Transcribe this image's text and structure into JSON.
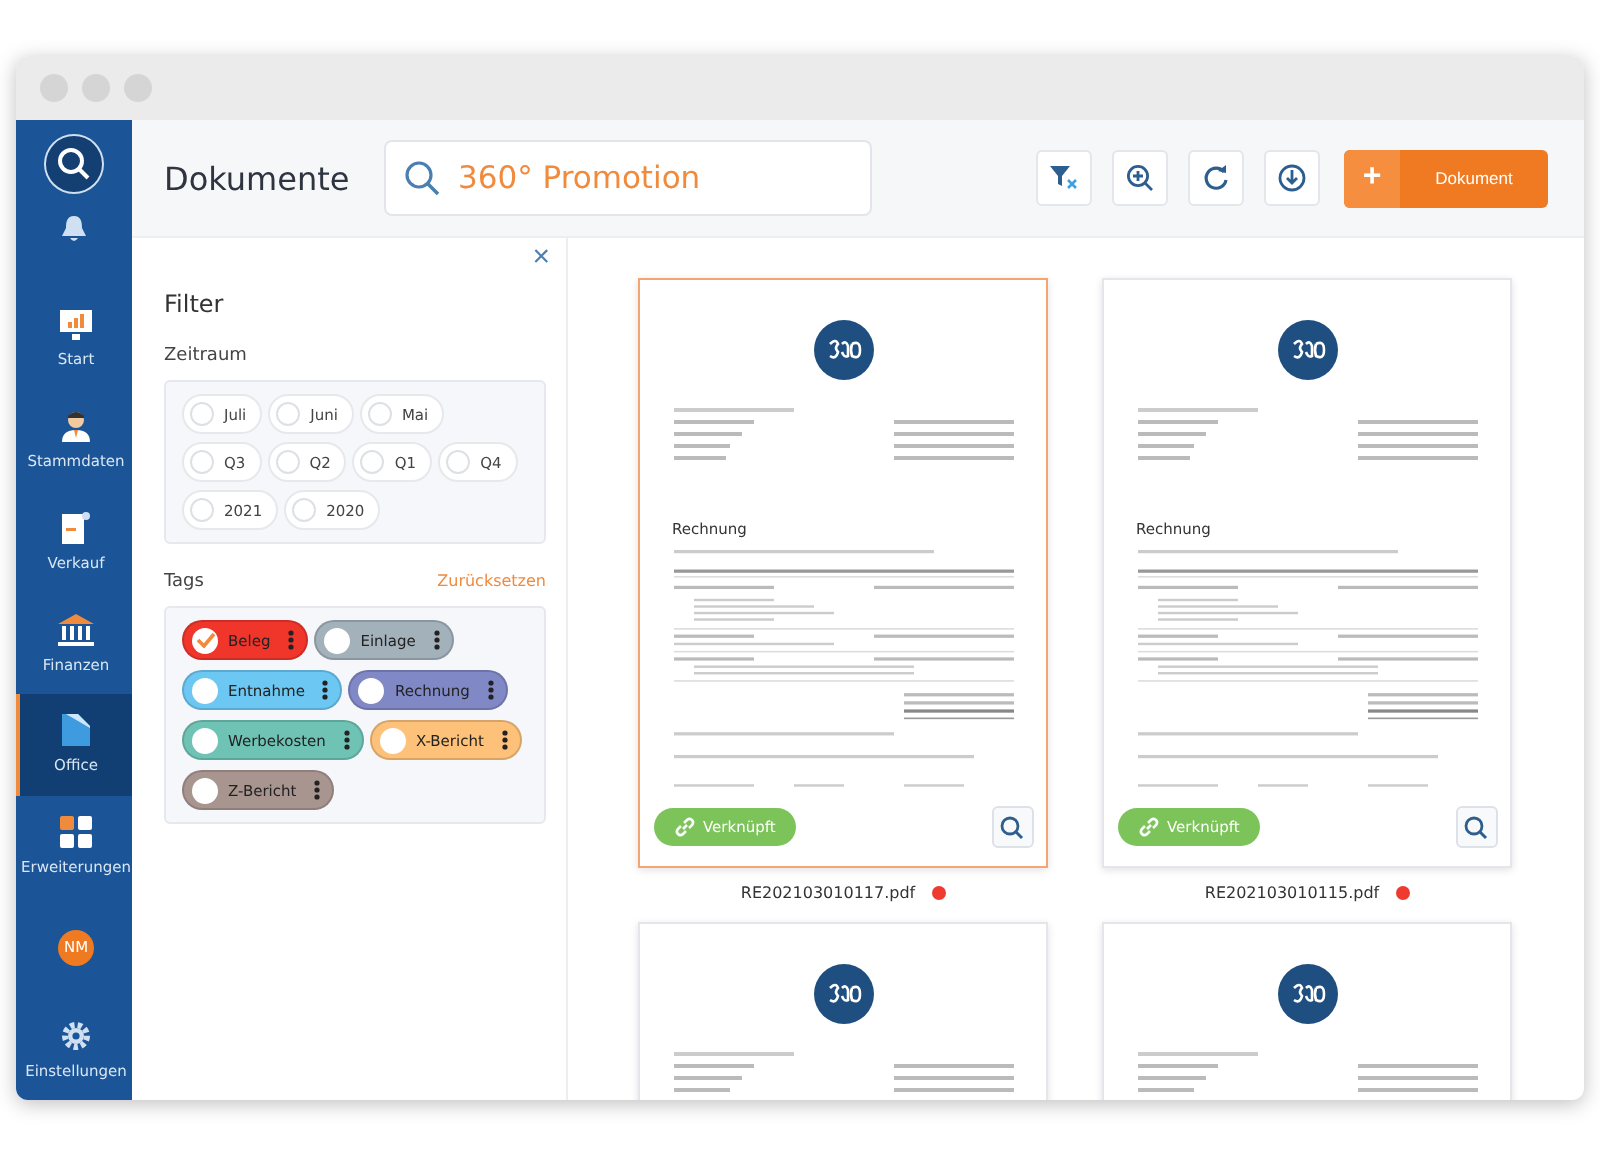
{
  "sidebar": {
    "items": [
      {
        "kind": "search"
      },
      {
        "kind": "bell"
      },
      {
        "kind": "chart",
        "label": "Start",
        "selected": false
      },
      {
        "kind": "person",
        "label": "Stammdaten",
        "selected": false
      },
      {
        "kind": "doc",
        "label": "Verkauf",
        "selected": false
      },
      {
        "kind": "bank",
        "label": "Finanzen",
        "selected": false
      },
      {
        "kind": "office",
        "label": "Office",
        "selected": true
      },
      {
        "kind": "grid",
        "label": "Erweiterungen",
        "selected": false
      },
      {
        "kind": "avatar",
        "label": "NM"
      },
      {
        "kind": "gear",
        "label": "Einstellungen",
        "selected": false
      }
    ]
  },
  "header": {
    "title": "Dokumente",
    "search": {
      "value": "360° Promotion"
    },
    "new_button": {
      "icon": "+",
      "label": "Dokument"
    }
  },
  "filter": {
    "title": "Filter",
    "close": "×",
    "period_label": "Zeitraum",
    "periods": [
      {
        "label": "Juli",
        "selected": false
      },
      {
        "label": "Juni",
        "selected": false
      },
      {
        "label": "Mai",
        "selected": false
      },
      {
        "label": "Q3",
        "selected": false
      },
      {
        "label": "Q2",
        "selected": false
      },
      {
        "label": "Q1",
        "selected": false
      },
      {
        "label": "Q4",
        "selected": false
      },
      {
        "label": "2021",
        "selected": false
      },
      {
        "label": "2020",
        "selected": false
      }
    ],
    "tags_label": "Tags",
    "reset": "Zurücksetzen",
    "tags": [
      {
        "label": "Beleg",
        "checked": true,
        "color": "#f0352b"
      },
      {
        "label": "Einlage",
        "checked": false,
        "color": "#a3b1bb"
      },
      {
        "label": "Entnahme",
        "checked": false,
        "color": "#6cc7f2"
      },
      {
        "label": "Rechnung",
        "checked": false,
        "color": "#8088c6"
      },
      {
        "label": "Werbekosten",
        "checked": false,
        "color": "#6fc3b5"
      },
      {
        "label": "X-Bericht",
        "checked": false,
        "color": "#fdc17a"
      },
      {
        "label": "Z-Bericht",
        "checked": false,
        "color": "#a89590"
      }
    ]
  },
  "documents": [
    {
      "heading": "Rechnung",
      "selected": true,
      "link": "Verknüpft",
      "filename": "RE202103010117.pdf",
      "color": "#ef3a2e"
    },
    {
      "heading": "Rechnung",
      "selected": false,
      "link": "Verknüpft",
      "filename": "RE202103010115.pdf",
      "color": "#ef3a2e"
    },
    {
      "selected": false
    },
    {
      "selected": false
    }
  ]
}
